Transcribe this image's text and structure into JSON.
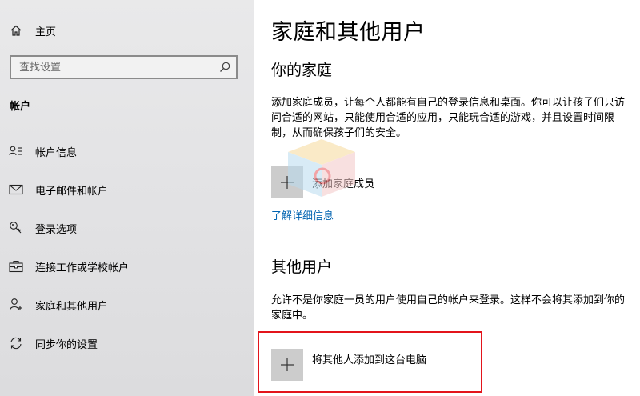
{
  "sidebar": {
    "home_label": "主页",
    "search_placeholder": "查找设置",
    "section_header": "帐户",
    "items": [
      {
        "label": "帐户信息",
        "icon": "user-info-icon"
      },
      {
        "label": "电子邮件和帐户",
        "icon": "mail-icon"
      },
      {
        "label": "登录选项",
        "icon": "key-icon"
      },
      {
        "label": "连接工作或学校帐户",
        "icon": "briefcase-icon"
      },
      {
        "label": "家庭和其他用户",
        "icon": "people-icon"
      },
      {
        "label": "同步你的设置",
        "icon": "sync-icon"
      }
    ]
  },
  "main": {
    "title": "家庭和其他用户",
    "family": {
      "heading": "你的家庭",
      "description": "添加家庭成员，让每个人都能有自己的登录信息和桌面。你可以让孩子们只访问合适的网站，只能使用合适的应用，只能玩合适的游戏，并且设置时间限制，从而确保孩子们的安全。",
      "add_label": "添加家庭成员",
      "link": "了解详细信息"
    },
    "others": {
      "heading": "其他用户",
      "description": "允许不是你家庭一员的用户使用自己的帐户来登录。这样不会将其添加到你的家庭中。",
      "add_label": "将其他人添加到这台电脑"
    }
  },
  "colors": {
    "accent_link": "#0063b1",
    "highlight_border": "#e3141b",
    "sidebar_bg": "#e6e6e8",
    "tile_bg": "#cccccc"
  }
}
